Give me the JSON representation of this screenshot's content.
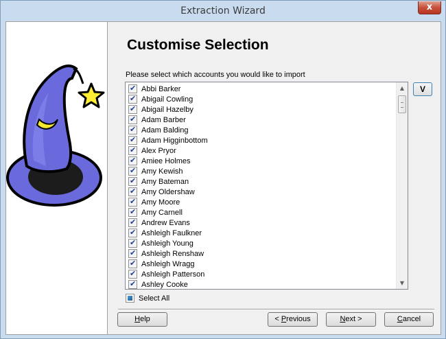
{
  "window": {
    "title": "Extraction Wizard",
    "close_glyph": "x"
  },
  "page": {
    "heading": "Customise Selection",
    "instruction": "Please select which accounts you would like to import"
  },
  "accounts": [
    "Abbi Barker",
    "Abigail Cowling",
    "Abigail Hazelby",
    "Adam Barber",
    "Adam Balding",
    "Adam Higginbottom",
    "Alex Pryor",
    "Amiee Holmes",
    "Amy Kewish",
    "Amy Bateman",
    "Amy Oldershaw",
    "Amy Moore",
    "Amy Carnell",
    "Andrew Evans",
    "Ashleigh Faulkner",
    "Ashleigh Young",
    "Ashleigh Renshaw",
    "Ashleigh Wragg",
    "Ashleigh Patterson",
    "Ashley Cooke"
  ],
  "accounts_checked": true,
  "v_button": {
    "label": "V"
  },
  "select_all": {
    "label": "Select All",
    "state": "indeterminate"
  },
  "buttons": {
    "help": {
      "pre": "",
      "ul": "H",
      "post": "elp"
    },
    "previous": {
      "pre": "< ",
      "ul": "P",
      "post": "revious"
    },
    "next": {
      "pre": "",
      "ul": "N",
      "post": "ext >"
    },
    "cancel": {
      "pre": "",
      "ul": "C",
      "post": "ancel"
    }
  },
  "icons": {
    "wizard_hat": "wizard-hat-icon",
    "checkbox": "check-icon",
    "scroll_up": "chevron-up-icon",
    "scroll_down": "chevron-down-icon"
  },
  "colors": {
    "hat": "#6a6add",
    "hat_dark": "#2d2d8a",
    "star": "#ffee33",
    "moon": "#f2e830"
  }
}
